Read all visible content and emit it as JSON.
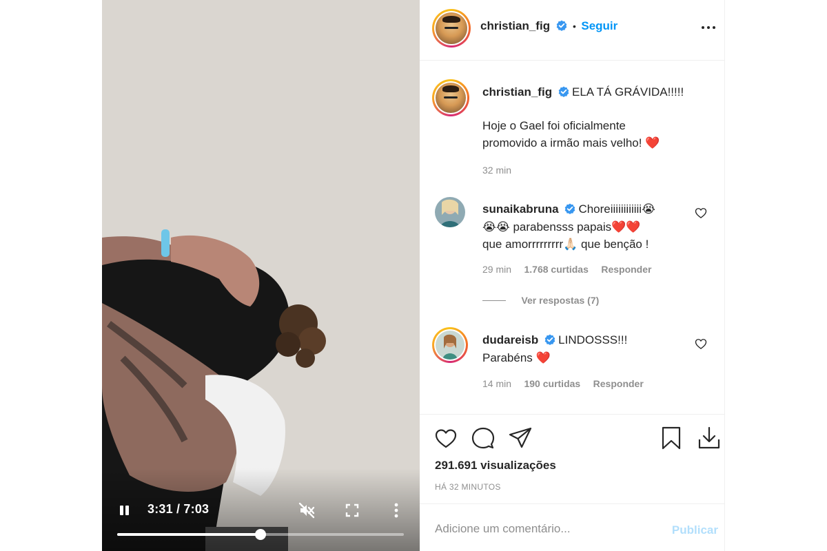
{
  "video": {
    "time_label": "3:31 / 7:03",
    "progress": 0.499,
    "playing": true,
    "muted": true
  },
  "post": {
    "username": "christian_fig",
    "verified": true,
    "follow_separator": "•",
    "follow_label": "Seguir",
    "caption": {
      "headline": "ELA TÁ GRÁVIDA!!!!!",
      "line1": "Hoje o Gael foi oficialmente",
      "line2": "promovido a irmão mais velho!",
      "emoji": "❤️",
      "time": "32 min"
    }
  },
  "comments": [
    {
      "username": "sunaikabruna",
      "line1": "Choreiiiiiiiiiiii😭",
      "line2": "😭😭 parabensss papais❤️❤️",
      "line3": "que amorrrrrrrrr🙏🏻 que benção !",
      "time": "29 min",
      "likes": "1.768 curtidas",
      "reply_label": "Responder",
      "view_replies": "Ver respostas (7)"
    },
    {
      "username": "dudareisb",
      "line1": "LINDOSSS!!!",
      "line2": "Parabéns ❤️",
      "time": "14 min",
      "likes": "190 curtidas",
      "reply_label": "Responder"
    }
  ],
  "stats": {
    "views": "291.691 visualizações",
    "posted_ago": "HÁ 32 MINUTOS"
  },
  "composer": {
    "placeholder": "Adicione um comentário...",
    "publish_label": "Publicar"
  },
  "colors": {
    "accent": "#0095f6",
    "publish_disabled": "#b2dffc",
    "verified": "#3897f0",
    "emoji_heart": "#e0102e"
  }
}
